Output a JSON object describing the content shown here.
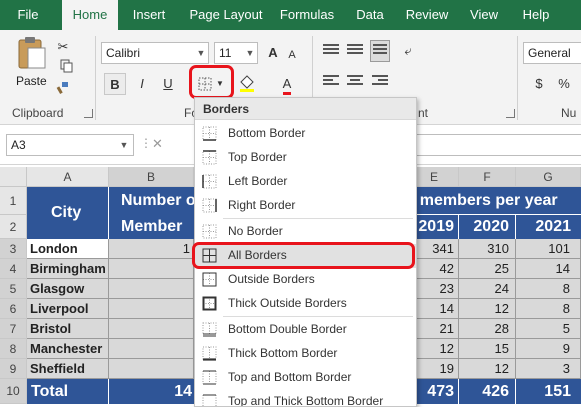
{
  "tabs": [
    "File",
    "Home",
    "Insert",
    "Page Layout",
    "Formulas",
    "Data",
    "Review",
    "View",
    "Help"
  ],
  "ribbon": {
    "clipboard": {
      "paste_label": "Paste",
      "group_label": "Clipboard"
    },
    "font": {
      "font_name": "Calibri",
      "font_size": "11",
      "bold": "B",
      "italic": "I",
      "increase": "A",
      "decrease": "A",
      "font_color": "A",
      "group_label_partial": "Fo"
    },
    "alignment": {
      "group_label_partial": "nt"
    },
    "number": {
      "format": "General",
      "group_label_partial": "Nu"
    }
  },
  "formula_bar": {
    "name_box": "A3",
    "cancel": "✕"
  },
  "columns": [
    "A",
    "B",
    "E",
    "F",
    "G"
  ],
  "rows": [
    "1",
    "2",
    "3",
    "4",
    "5",
    "6",
    "7",
    "8",
    "9",
    "10"
  ],
  "sheet": {
    "city_header": "City",
    "number_header_top": "Number o",
    "number_header_bottom": "Member",
    "members_header": "f members per year",
    "years": [
      "2019",
      "2020",
      "2021"
    ],
    "data_rows": [
      {
        "city": "London",
        "b": "1",
        "e": "341",
        "f": "310",
        "g": "101"
      },
      {
        "city": "Birmingham",
        "b": "",
        "e": "42",
        "f": "25",
        "g": "14"
      },
      {
        "city": "Glasgow",
        "b": "",
        "e": "23",
        "f": "24",
        "g": "8"
      },
      {
        "city": "Liverpool",
        "b": "",
        "e": "14",
        "f": "12",
        "g": "8"
      },
      {
        "city": "Bristol",
        "b": "",
        "e": "21",
        "f": "28",
        "g": "5"
      },
      {
        "city": "Manchester",
        "b": "",
        "e": "12",
        "f": "15",
        "g": "9"
      },
      {
        "city": "Sheffield",
        "b": "",
        "e": "19",
        "f": "12",
        "g": "3"
      }
    ],
    "total": {
      "label": "Total",
      "b": "14",
      "e": "473",
      "f": "426",
      "g": "151"
    }
  },
  "menu": {
    "title": "Borders",
    "items": [
      "Bottom Border",
      "Top Border",
      "Left Border",
      "Right Border",
      "No Border",
      "All Borders",
      "Outside Borders",
      "Thick Outside Borders",
      "Bottom Double Border",
      "Thick Bottom Border",
      "Top and Bottom Border",
      "Top and Thick Bottom Border"
    ]
  },
  "colors": {
    "excel_green": "#217346",
    "header_blue": "#2f5597",
    "highlight_red": "#e8141c",
    "selection_gray": "#d9d9d9"
  }
}
